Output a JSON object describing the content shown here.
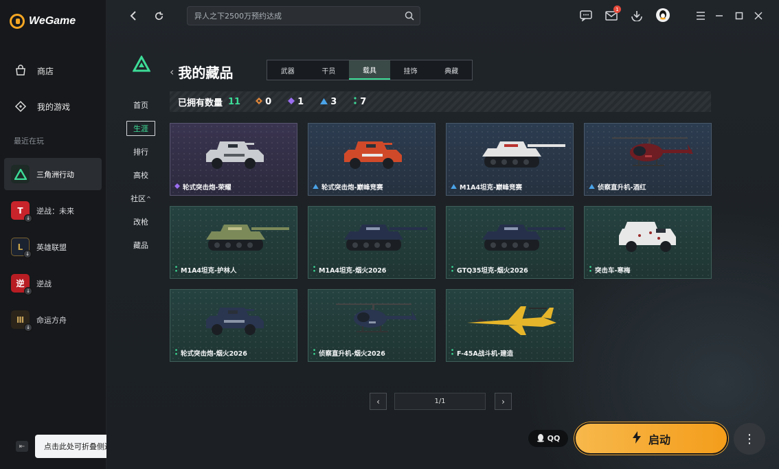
{
  "app": {
    "logo_text": "WeGame"
  },
  "sidebar": {
    "nav": [
      {
        "label": "商店",
        "icon": "store-icon"
      },
      {
        "label": "我的游戏",
        "icon": "my-games-icon"
      }
    ],
    "recent_label": "最近在玩",
    "recent": [
      {
        "label": "三角洲行动",
        "active": true
      },
      {
        "label": "逆战：未来"
      },
      {
        "label": "英雄联盟"
      },
      {
        "label": "逆战"
      },
      {
        "label": "命运方舟"
      }
    ],
    "collapse_tooltip": "点击此处可折叠侧边栏"
  },
  "topbar": {
    "search_placeholder": "异人之下2500万预约达成",
    "mail_badge": "1"
  },
  "game_nav": {
    "items": [
      "首页",
      "生涯",
      "排行",
      "高校",
      "社区",
      "改枪",
      "藏品"
    ],
    "active": "生涯",
    "community_caret": "^"
  },
  "collection": {
    "title": "我的藏品",
    "tabs": [
      "武器",
      "干员",
      "载具",
      "挂饰",
      "典藏"
    ],
    "active_tab": "载具",
    "owned_label": "已拥有数量",
    "owned_total": "11",
    "rarity_counts": [
      {
        "color": "#e0873a",
        "count": "0"
      },
      {
        "color": "#9b6ef0",
        "count": "1"
      },
      {
        "color": "#4aa3e8",
        "count": "3"
      },
      {
        "color": "#3ddc97",
        "count": "7"
      }
    ],
    "items": [
      {
        "name": "轮式突击炮-荣耀",
        "rarity": "purple",
        "rarity_color": "#9b6ef0",
        "art": "armored-car"
      },
      {
        "name": "轮式突击炮-巅峰竞赛",
        "rarity": "blue",
        "rarity_color": "#4aa3e8",
        "art": "armored-car-red"
      },
      {
        "name": "M1A4坦克-巅峰竞赛",
        "rarity": "blue",
        "rarity_color": "#4aa3e8",
        "art": "tank-white"
      },
      {
        "name": "侦察直升机-酒红",
        "rarity": "blue",
        "rarity_color": "#4aa3e8",
        "art": "helicopter-red"
      },
      {
        "name": "M1A4坦克-护林人",
        "rarity": "green",
        "rarity_color": "#3ddc97",
        "art": "tank-camo"
      },
      {
        "name": "M1A4坦克-烟火2026",
        "rarity": "green",
        "rarity_color": "#3ddc97",
        "art": "tank-navy"
      },
      {
        "name": "GTQ35坦克-烟火2026",
        "rarity": "green",
        "rarity_color": "#3ddc97",
        "art": "tank-navy"
      },
      {
        "name": "突击车-寒梅",
        "rarity": "green",
        "rarity_color": "#3ddc97",
        "art": "apc-white"
      },
      {
        "name": "轮式突击炮-烟火2026",
        "rarity": "green",
        "rarity_color": "#3ddc97",
        "art": "armored-car-navy"
      },
      {
        "name": "侦察直升机-烟火2026",
        "rarity": "green",
        "rarity_color": "#3ddc97",
        "art": "helicopter-navy"
      },
      {
        "name": "F-45A战斗机-建造",
        "rarity": "green",
        "rarity_color": "#3ddc97",
        "art": "jet-yellow"
      }
    ]
  },
  "pager": {
    "label": "1/1",
    "prev": "‹",
    "next": "›"
  },
  "footer": {
    "qq_label": "QQ",
    "launch_label": "启动",
    "more_label": "⋮"
  }
}
